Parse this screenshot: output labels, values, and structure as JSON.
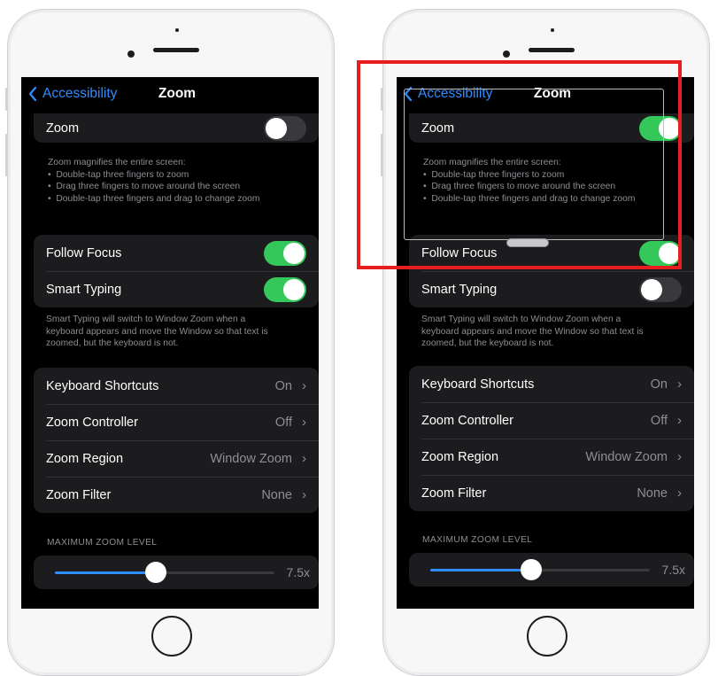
{
  "left_phone": {
    "nav": {
      "back_label": "Accessibility",
      "title": "Zoom"
    },
    "zoom_row": {
      "label": "Zoom",
      "toggle": "off"
    },
    "zoom_note": {
      "heading": "Zoom magnifies the entire screen:",
      "items": [
        "Double-tap three fingers to zoom",
        "Drag three fingers to move around the screen",
        "Double-tap three fingers and drag to change zoom"
      ]
    },
    "follow_focus": {
      "label": "Follow Focus",
      "toggle": "on"
    },
    "smart_typing": {
      "label": "Smart Typing",
      "toggle": "on"
    },
    "smart_typing_note": [
      "Smart Typing will switch to Window Zoom when a",
      "keyboard appears and move the Window so that text is",
      "zoomed, but the keyboard is not."
    ],
    "settings": [
      {
        "label": "Keyboard Shortcuts",
        "value": "On"
      },
      {
        "label": "Zoom Controller",
        "value": "Off"
      },
      {
        "label": "Zoom Region",
        "value": "Window Zoom"
      },
      {
        "label": "Zoom Filter",
        "value": "None"
      }
    ],
    "max_zoom": {
      "header": "MAXIMUM ZOOM LEVEL",
      "value": "7.5x",
      "slider_fraction": 0.46
    }
  },
  "right_phone": {
    "nav": {
      "back_label": "Accessibility",
      "title": "Zoom"
    },
    "zoom_row": {
      "label": "Zoom",
      "toggle": "on"
    },
    "zoom_note": {
      "heading": "Zoom magnifies the entire screen:",
      "items": [
        "Double-tap three fingers to zoom",
        "Drag three fingers to move around the screen",
        "Double-tap three fingers and drag to change zoom"
      ]
    },
    "follow_focus": {
      "label": "Follow Focus",
      "toggle": "on"
    },
    "smart_typing": {
      "label": "Smart Typing",
      "toggle": "off"
    },
    "smart_typing_note": [
      "Smart Typing will switch to Window Zoom when a",
      "keyboard appears and move the Window so that text is",
      "zoomed, but the keyboard is not."
    ],
    "settings": [
      {
        "label": "Keyboard Shortcuts",
        "value": "On"
      },
      {
        "label": "Zoom Controller",
        "value": "Off"
      },
      {
        "label": "Zoom Region",
        "value": "Window Zoom"
      },
      {
        "label": "Zoom Filter",
        "value": "None"
      }
    ],
    "max_zoom": {
      "header": "MAXIMUM ZOOM LEVEL",
      "value": "7.5x",
      "slider_fraction": 0.46
    }
  },
  "colors": {
    "accent_blue": "#2f8cff",
    "toggle_on": "#34c759",
    "highlight_red": "#e81e1e",
    "cell_background": "#1c1c1e"
  },
  "icons": {
    "back": "chevron-left-icon",
    "disclosure": "chevron-right-icon"
  }
}
